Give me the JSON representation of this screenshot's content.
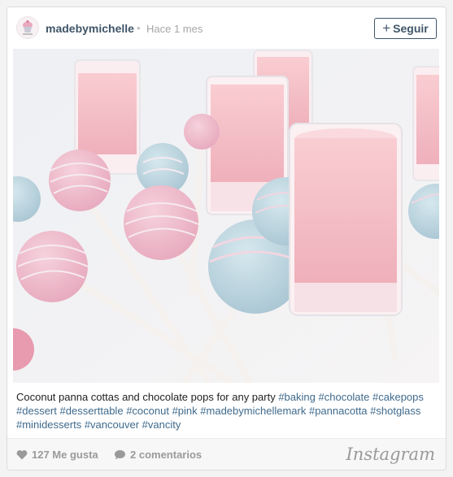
{
  "header": {
    "username": "madebymichelle",
    "separator": "•",
    "time": "Hace 1 mes",
    "follow_label": "Seguir",
    "follow_plus": "+"
  },
  "caption": {
    "text": "Coconut panna cottas and chocolate pops for any party ",
    "hashtags": [
      "#baking",
      "#chocolate",
      "#cakepops",
      "#dessert",
      "#desserttable",
      "#coconut",
      "#pink",
      "#madebymichellemark",
      "#pannacotta",
      "#shotglass",
      "#minidesserts",
      "#vancouver",
      "#vancity"
    ]
  },
  "footer": {
    "likes": "127 Me gusta",
    "comments": "2 comentarios",
    "brand": "Instagram"
  },
  "icons": {
    "heart": "heart-icon",
    "comment": "comment-bubble-icon",
    "plus": "plus-icon"
  },
  "colors": {
    "accent": "#3f5568",
    "hashtag": "#3f6a8c",
    "muted": "#9a9a9a",
    "pink": "#f3b9c4",
    "blue": "#b8d3de"
  }
}
